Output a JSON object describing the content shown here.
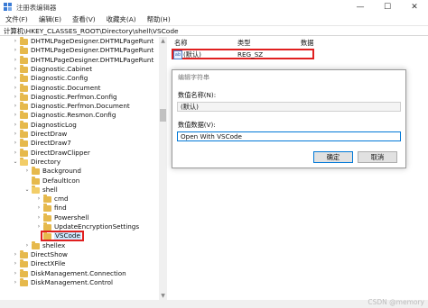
{
  "window": {
    "title": "注册表编辑器"
  },
  "menu": [
    "文件(F)",
    "编辑(E)",
    "查看(V)",
    "收藏夹(A)",
    "帮助(H)"
  ],
  "address": "计算机\\HKEY_CLASSES_ROOT\\Directory\\shell\\VSCode",
  "tree": [
    {
      "label": "DHTMLPageDesigner.DHTMLPageRunt",
      "depth": 0,
      "expander": "›"
    },
    {
      "label": "DHTMLPageDesigner.DHTMLPageRunt",
      "depth": 0,
      "expander": "›"
    },
    {
      "label": "DHTMLPageDesigner.DHTMLPageRunt",
      "depth": 0,
      "expander": "›"
    },
    {
      "label": "Diagnostic.Cabinet",
      "depth": 0,
      "expander": "›"
    },
    {
      "label": "Diagnostic.Config",
      "depth": 0,
      "expander": "›"
    },
    {
      "label": "Diagnostic.Document",
      "depth": 0,
      "expander": "›"
    },
    {
      "label": "Diagnostic.Perfmon.Config",
      "depth": 0,
      "expander": "›"
    },
    {
      "label": "Diagnostic.Perfmon.Document",
      "depth": 0,
      "expander": "›"
    },
    {
      "label": "Diagnostic.Resmon.Config",
      "depth": 0,
      "expander": "›"
    },
    {
      "label": "DiagnosticLog",
      "depth": 0,
      "expander": "›"
    },
    {
      "label": "DirectDraw",
      "depth": 0,
      "expander": "›"
    },
    {
      "label": "DirectDraw7",
      "depth": 0,
      "expander": "›"
    },
    {
      "label": "DirectDrawClipper",
      "depth": 0,
      "expander": "›"
    },
    {
      "label": "Directory",
      "depth": 0,
      "expander": "⌄"
    },
    {
      "label": "Background",
      "depth": 1,
      "expander": "›"
    },
    {
      "label": "DefaultIcon",
      "depth": 1,
      "expander": ""
    },
    {
      "label": "shell",
      "depth": 1,
      "expander": "⌄"
    },
    {
      "label": "cmd",
      "depth": 2,
      "expander": "›"
    },
    {
      "label": "find",
      "depth": 2,
      "expander": "›"
    },
    {
      "label": "Powershell",
      "depth": 2,
      "expander": "›"
    },
    {
      "label": "UpdateEncryptionSettings",
      "depth": 2,
      "expander": "›"
    },
    {
      "label": "VSCode",
      "depth": 2,
      "expander": "",
      "selected": true
    },
    {
      "label": "shellex",
      "depth": 1,
      "expander": "›"
    },
    {
      "label": "DirectShow",
      "depth": 0,
      "expander": "›"
    },
    {
      "label": "DirectXFile",
      "depth": 0,
      "expander": "›"
    },
    {
      "label": "DiskManagement.Connection",
      "depth": 0,
      "expander": "›"
    },
    {
      "label": "DiskManagement.Control",
      "depth": 0,
      "expander": "›"
    }
  ],
  "columns": {
    "name": "名称",
    "type": "类型",
    "data": "数据"
  },
  "value_row": {
    "icon": "ab",
    "name": "(默认)",
    "type": "REG_SZ"
  },
  "dialog": {
    "title": "编辑字符串",
    "name_label": "数值名称(N):",
    "name_value": "(默认)",
    "data_label": "数值数据(V):",
    "data_value": "Open With VSCode",
    "ok": "确定",
    "cancel": "取消"
  },
  "watermark": "CSDN @memory",
  "colors": {
    "highlight": "#e02020",
    "accent": "#0078d7"
  }
}
